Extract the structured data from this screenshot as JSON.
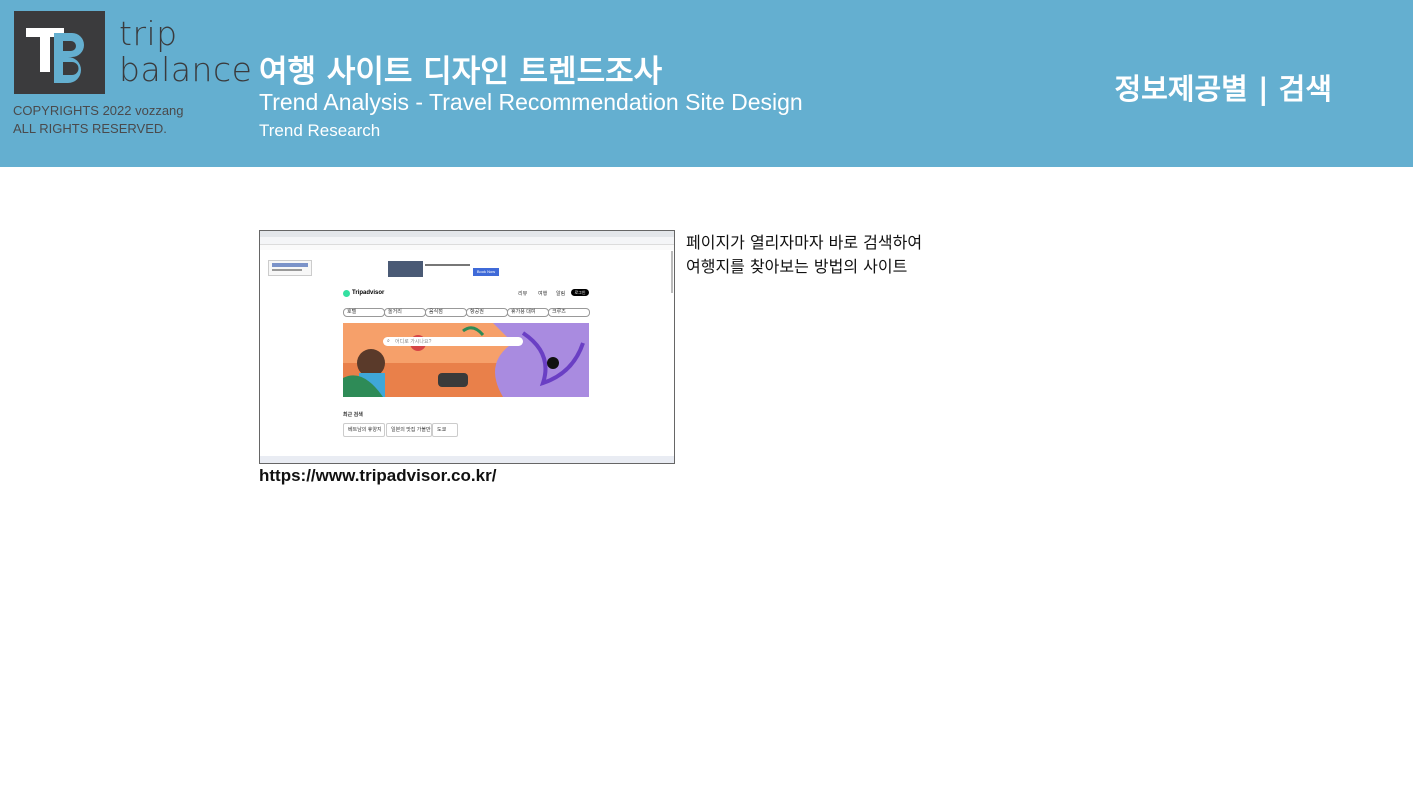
{
  "logo": {
    "brand_line1": "trip",
    "brand_line2": "balance",
    "mark_letters": "TB",
    "copyright_line1": "COPYRIGHTS 2022 vozzang",
    "copyright_line2": "ALL RIGHTS RESERVED."
  },
  "header": {
    "title_ko": "여행 사이트 디자인 트렌드조사",
    "title_en": "Trend Analysis - Travel Recommendation Site Design",
    "subtitle": "Trend Research",
    "category": "정보제공별 | 검색"
  },
  "content": {
    "description_line1": "페이지가 열리자마자 바로 검색하여",
    "description_line2": "여행지를 찾아보는 방법의 사이트",
    "url": "https://www.tripadvisor.co.kr/"
  },
  "screenshot": {
    "brand": "Tripadvisor",
    "ad_button": "Book Now",
    "menu_items": [
      "리뷰",
      "여행",
      "알림"
    ],
    "login_button": "로그인",
    "categories": [
      "호텔",
      "놀거리",
      "음식점",
      "항공권",
      "휴가용 대여",
      "크루즈"
    ],
    "search_placeholder": "어디로 가시나요?",
    "recent_heading": "최근 검색",
    "recent_items": [
      "베트남의 휴양지",
      "일본의 맛집 가볼만한 곳",
      "도쿄"
    ]
  },
  "colors": {
    "header_bg": "#64afd0",
    "logo_dark": "#3b3b3d",
    "logo_blue": "#64afd0",
    "brand_green": "#34e0a1"
  }
}
